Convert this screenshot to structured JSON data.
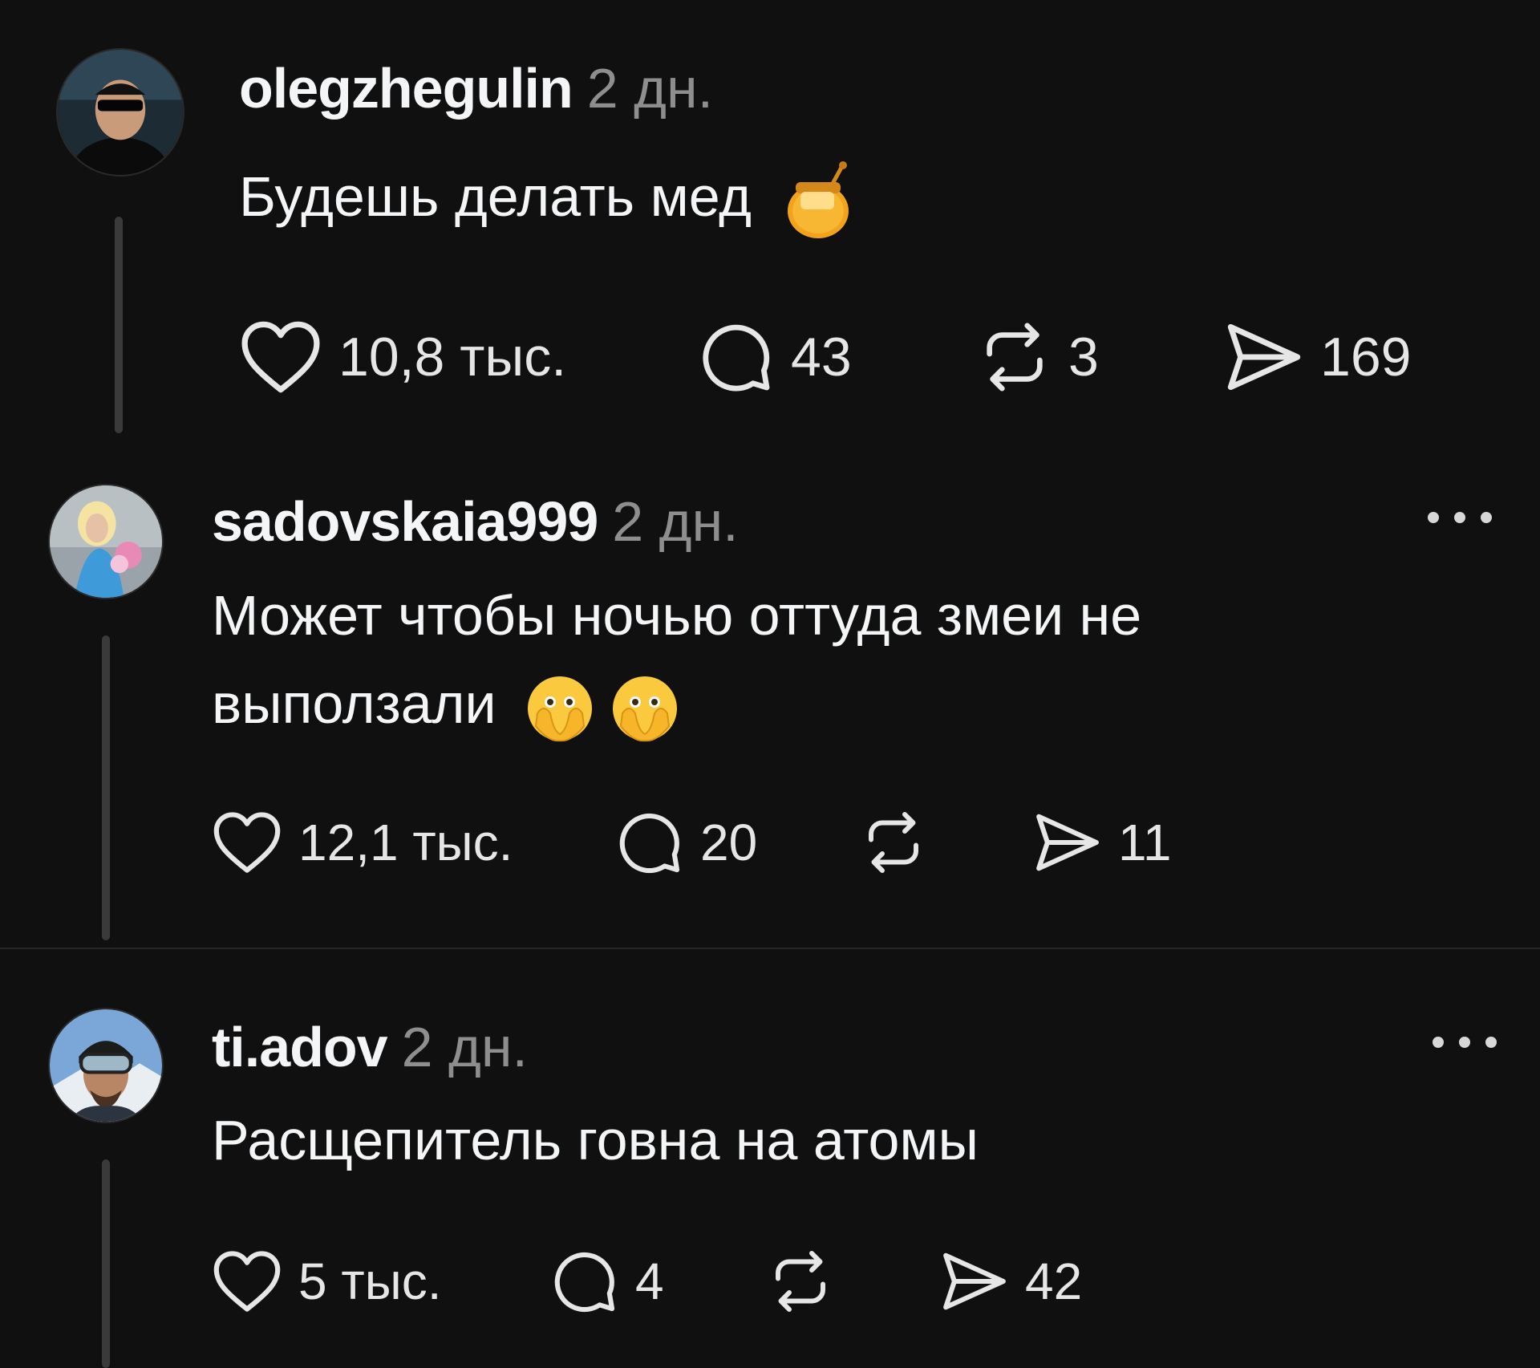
{
  "posts": [
    {
      "username": "olegzhegulin",
      "time": "2 дн.",
      "text": "Будешь делать мед",
      "emoji": [
        "honey-pot"
      ],
      "likes": "10,8 тыс.",
      "comments": "43",
      "reposts": "3",
      "shares": "169"
    },
    {
      "username": "sadovskaia999",
      "time": "2 дн.",
      "text_line1": "Может чтобы ночью оттуда змеи не",
      "text_line2": "выползали",
      "emoji": [
        "face-with-open-eyes-and-hand-over-mouth",
        "face-with-open-eyes-and-hand-over-mouth"
      ],
      "likes": "12,1 тыс.",
      "comments": "20",
      "reposts": "",
      "shares": "11"
    },
    {
      "username": "ti.adov",
      "time": "2 дн.",
      "text": "Расщепитель говна на атомы",
      "likes": "5 тыс.",
      "comments": "4",
      "reposts": "",
      "shares": "42"
    }
  ],
  "icons": {
    "like": "heart-icon",
    "comment": "comment-bubble-icon",
    "repost": "repost-icon",
    "share": "send-icon",
    "more": "more-options-icon"
  },
  "colors": {
    "background": "#101010",
    "text": "#f3f5f7",
    "secondary": "#8e8e8e",
    "thread_line": "#3a3a3a"
  }
}
